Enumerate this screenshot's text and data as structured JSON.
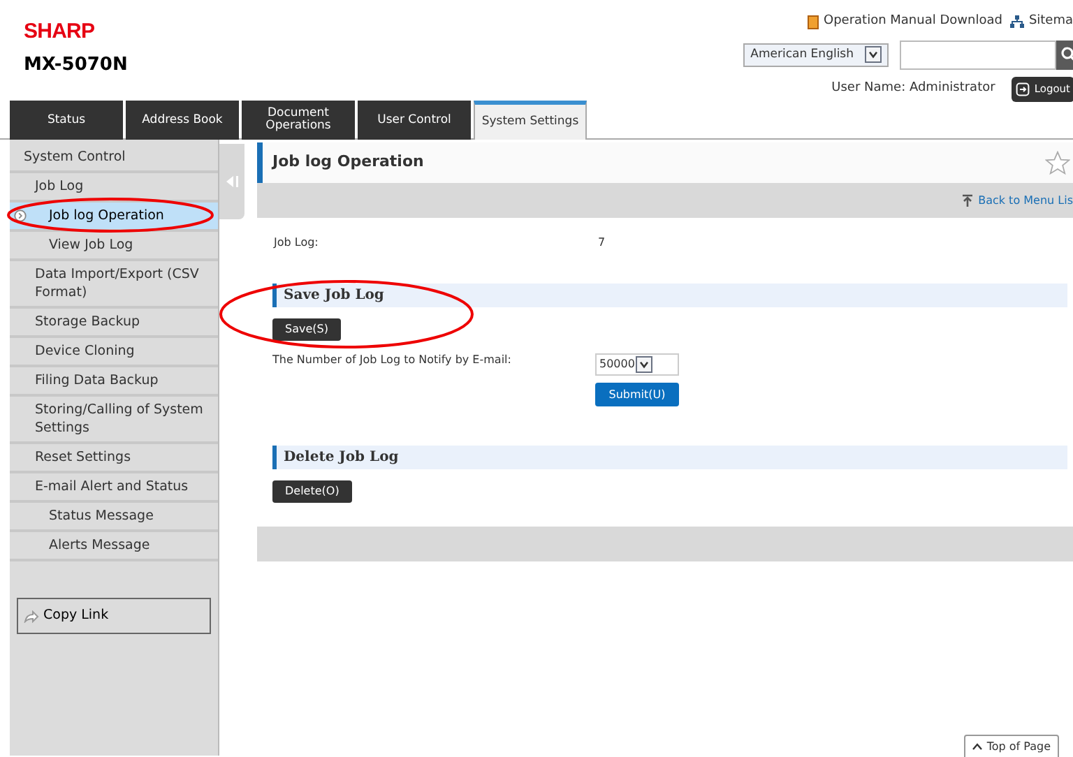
{
  "header": {
    "logo": "SHARP",
    "model": "MX-5070N",
    "links": [
      {
        "kind": "manual",
        "label": "Operation Manual Download"
      },
      {
        "kind": "sitemap",
        "label": "Sitema"
      }
    ],
    "language": "American English",
    "user_name": "User Name: Administrator",
    "logout": "Logout"
  },
  "tabs": [
    {
      "label": "Status",
      "selected": false
    },
    {
      "label": "Address Book",
      "selected": false
    },
    {
      "label": "Document Operations",
      "selected": false
    },
    {
      "label": "User Control",
      "selected": false
    },
    {
      "label": "System Settings",
      "selected": true
    }
  ],
  "sidebar": {
    "items": [
      {
        "label": "System Control",
        "selected": false,
        "children": [
          {
            "label": "Job Log",
            "selected": false,
            "children": [
              {
                "label": "Job log Operation",
                "selected": true
              },
              {
                "label": "View Job Log",
                "selected": false
              }
            ]
          },
          {
            "label": "Data Import/Export (CSV Format)",
            "selected": false
          },
          {
            "label": "Storage Backup",
            "selected": false
          },
          {
            "label": "Device Cloning",
            "selected": false
          },
          {
            "label": "Filing Data Backup",
            "selected": false
          },
          {
            "label": "Storing/Calling of System Settings",
            "selected": false
          },
          {
            "label": "Reset Settings",
            "selected": false
          },
          {
            "label": "E-mail Alert and Status",
            "selected": false,
            "children": [
              {
                "label": "Status Message",
                "selected": false
              },
              {
                "label": "Alerts Message",
                "selected": false
              }
            ]
          }
        ]
      }
    ],
    "copy_link": "Copy Link"
  },
  "page": {
    "title": "Job log Operation",
    "back_link": "Back to Menu Lis",
    "job_log": {
      "label": "Job Log:",
      "value": "7"
    },
    "sections": [
      {
        "title": "Save Job Log",
        "button": "Save(S)",
        "notify": {
          "label": "The Number of Job Log to Notify by E-mail:",
          "value": "50000",
          "submit": "Submit(U)"
        }
      },
      {
        "title": "Delete Job Log",
        "button": "Delete(O)"
      }
    ],
    "top_of_page": "Top of Page"
  }
}
